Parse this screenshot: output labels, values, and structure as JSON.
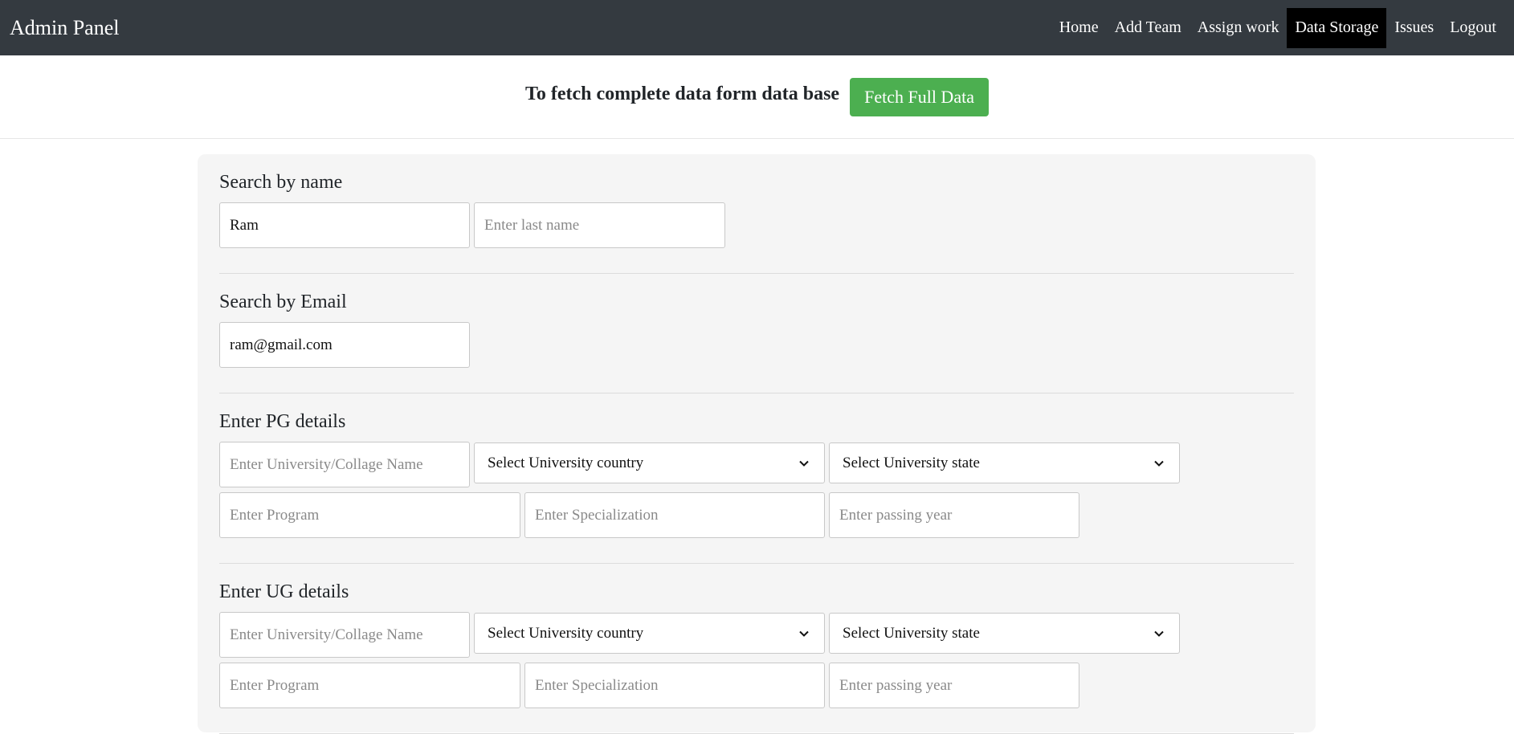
{
  "navbar": {
    "brand": "Admin Panel",
    "links": [
      {
        "label": "Home"
      },
      {
        "label": "Add Team"
      },
      {
        "label": "Assign work"
      },
      {
        "label": "Data Storage"
      },
      {
        "label": "Issues"
      },
      {
        "label": "Logout"
      }
    ],
    "active": "Data Storage"
  },
  "fetch": {
    "text": "To fetch complete data form data base",
    "button_label": "Fetch Full Data",
    "button_color": "#4caf50"
  },
  "search_name": {
    "title": "Search by name",
    "first_name_value": "Ram",
    "last_name_placeholder": "Enter last name"
  },
  "search_email": {
    "title": "Search by Email",
    "email_value": "ram@gmail.com"
  },
  "pg": {
    "title": "Enter PG details",
    "university_placeholder": "Enter University/Collage Name",
    "country_selected": "Select University country",
    "state_selected": "Select University state",
    "program_placeholder": "Enter Program",
    "specialization_placeholder": "Enter Specialization",
    "year_placeholder": "Enter passing year"
  },
  "ug": {
    "title": "Enter UG details",
    "university_placeholder": "Enter University/Collage Name",
    "country_selected": "Select University country",
    "state_selected": "Select University state",
    "program_placeholder": "Enter Program",
    "specialization_placeholder": "Enter Specialization",
    "year_placeholder": "Enter passing year"
  },
  "colors": {
    "navbar_bg": "#343a40",
    "active_tab_bg": "#000000",
    "card_bg": "#f5f5f5"
  }
}
